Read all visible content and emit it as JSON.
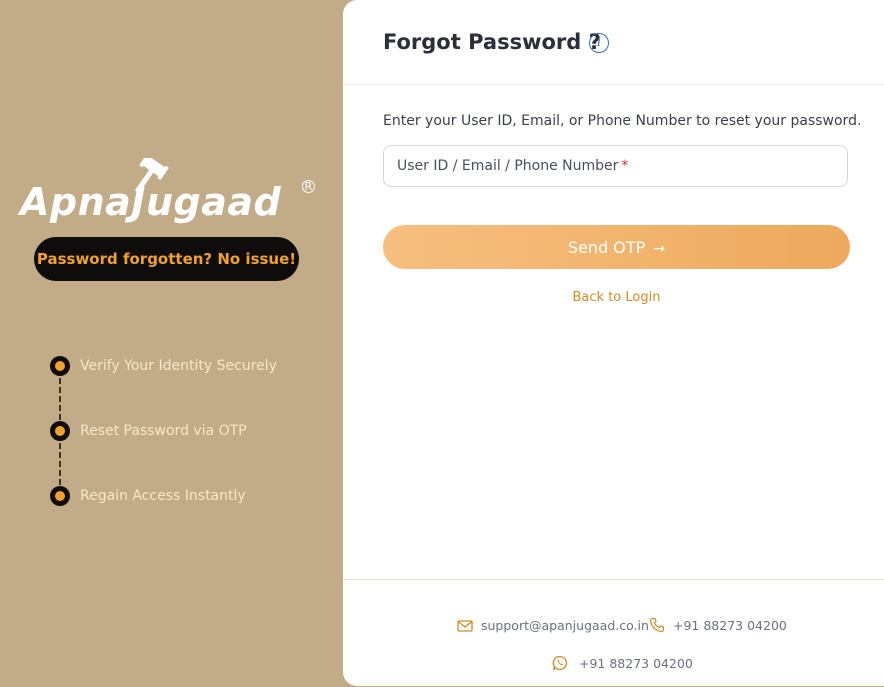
{
  "brand": {
    "logo_text": "ApnaJugaad",
    "registered_mark": "R",
    "tagline": "Password forgotten? No issue!"
  },
  "steps": [
    {
      "label": "Verify Your Identity Securely"
    },
    {
      "label": "Reset Password via OTP"
    },
    {
      "label": "Regain Access Instantly"
    }
  ],
  "form": {
    "title": "Forgot Password ?",
    "instruction": "Enter your User ID, Email, or Phone Number to reset your password.",
    "identifier_placeholder": "User ID / Email / Phone Number",
    "identifier_value": "",
    "required_mark": "*",
    "send_label": "Send OTP",
    "send_arrow": "→",
    "back_label": "Back to Login"
  },
  "footer": {
    "email": "support@apanjugaad.co.in",
    "phone": "+91 88273 04200",
    "whatsapp": "+91 88273 04200"
  },
  "colors": {
    "sidebar_bg": "#c2ac87",
    "accent": "#f0a12f",
    "button_start": "#f6bf7f",
    "button_end": "#eda95d",
    "link": "#d88a1f",
    "info": "#2f6fc4"
  }
}
